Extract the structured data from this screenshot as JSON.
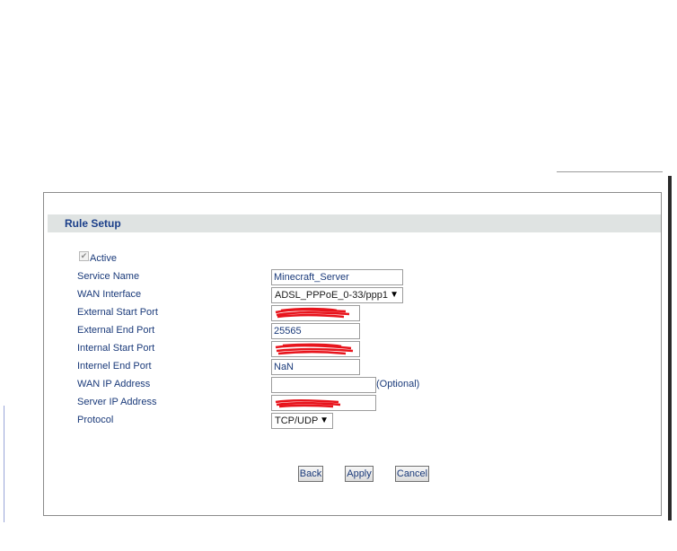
{
  "panel": {
    "title": "Rule Setup"
  },
  "form": {
    "active_label": "Active",
    "service_name_label": "Service Name",
    "service_name_value": "Minecraft_Server",
    "wan_interface_label": "WAN Interface",
    "wan_interface_value": "ADSL_PPPoE_0-33/ppp1",
    "external_start_port_label": "External Start Port",
    "external_end_port_label": "External End Port",
    "external_end_port_value": "25565",
    "internal_start_port_label": "Internal Start Port",
    "internal_end_port_label": "Internel End Port",
    "internal_end_port_value": "NaN",
    "wan_ip_label": "WAN IP Address",
    "wan_ip_hint": "(Optional)",
    "server_ip_label": "Server IP Address",
    "protocol_label": "Protocol",
    "protocol_value": "TCP/UDP"
  },
  "buttons": {
    "back": "Back",
    "apply": "Apply",
    "cancel": "Cancel"
  },
  "colors": {
    "label": "#1a3a7a",
    "header_bg": "#dfe3e2",
    "redaction": "#e8141c"
  }
}
